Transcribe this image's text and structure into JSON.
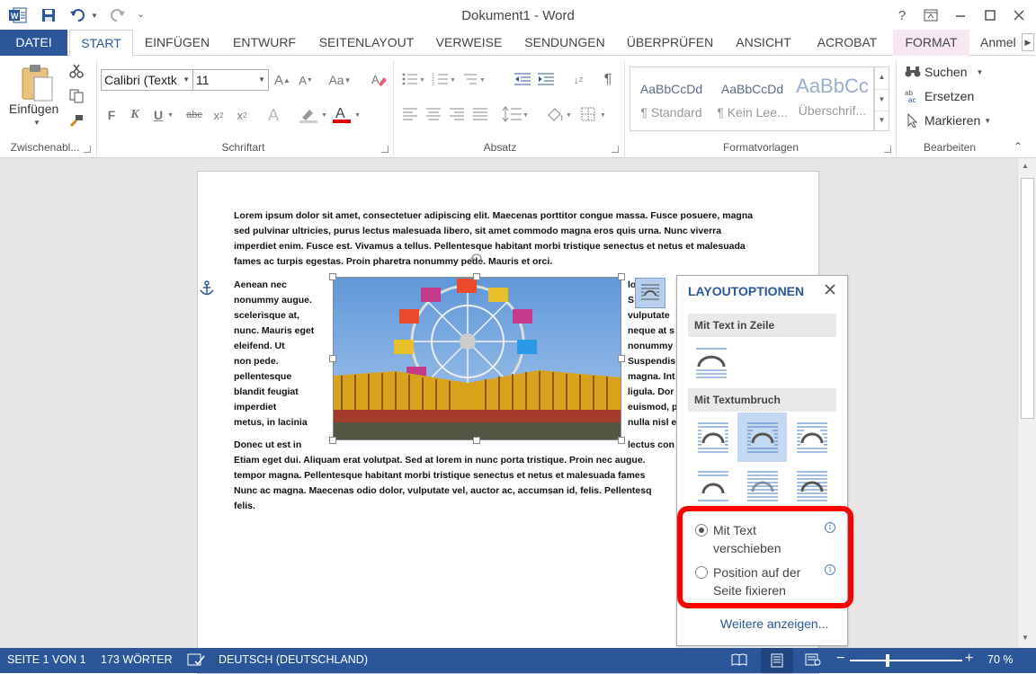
{
  "window": {
    "title": "Dokument1 - Word",
    "help": "?",
    "account": "Anmel"
  },
  "tabs": [
    "DATEI",
    "START",
    "EINFÜGEN",
    "ENTWURF",
    "SEITENLAYOUT",
    "VERWEISE",
    "SENDUNGEN",
    "ÜBERPRÜFEN",
    "ANSICHT",
    "ACROBAT",
    "FORMAT"
  ],
  "ribbon": {
    "clipboard": {
      "paste_label": "Einfügen",
      "group": "Zwischenabl..."
    },
    "font": {
      "family": "Calibri (Textk",
      "size": "11",
      "group": "Schriftart",
      "bold": "F",
      "italic": "K",
      "underline": "U",
      "strike": "abc"
    },
    "paragraph": {
      "group": "Absatz"
    },
    "styles": {
      "group": "Formatvorlagen",
      "items": [
        {
          "sample": "AaBbCcDd",
          "name": "¶ Standard"
        },
        {
          "sample": "AaBbCcDd",
          "name": "¶ Kein Lee..."
        },
        {
          "sample": "AaBbCc",
          "name": "Überschrif..."
        }
      ]
    },
    "editing": {
      "group": "Bearbeiten",
      "find": "Suchen",
      "replace": "Ersetzen",
      "select": "Markieren"
    }
  },
  "document": {
    "lines_top": [
      "Lorem ipsum dolor sit amet, consectetuer adipiscing elit. Maecenas porttitor congue massa. Fusce posuere, magna",
      "sed pulvinar ultricies, purus lectus malesuada libero, sit amet commodo magna eros quis urna. Nunc viverra",
      "imperdiet enim. Fusce est. Vivamus a tellus. Pellentesque habitant morbi tristique senectus et netus et malesuada",
      "fames ac turpis egestas. Proin pharetra nonummy pede. Mauris et orci."
    ],
    "lines_left": [
      "Aenean nec",
      "nonummy augue.",
      "scelerisque at,",
      "nunc. Mauris eget",
      "eleifend. Ut",
      "non pede.",
      "pellentesque",
      "blandit feugiat",
      "imperdiet",
      "metus, in lacinia"
    ],
    "lines_right": [
      "lo",
      "S",
      "vulputate",
      "neque at s",
      "nonummy",
      "Suspendis",
      "magna. Int",
      "ligula. Dor",
      "euismod, p",
      "nulla nisl e"
    ],
    "line_split": {
      "left": "Donec ut est in",
      "right": "lectus con"
    },
    "lines_bottom": [
      "Etiam eget dui. Aliquam erat volutpat. Sed at lorem in nunc porta tristique. Proin nec augue.",
      "tempor magna. Pellentesque habitant morbi tristique senectus et netus et malesuada fames",
      "Nunc ac magna. Maecenas odio dolor, vulputate vel, auctor ac, accumsan id, felis. Pellentesq",
      "felis."
    ]
  },
  "layout_panel": {
    "title": "LAYOUTOPTIONEN",
    "inline_header": "Mit Text in Zeile",
    "wrap_header": "Mit Textumbruch",
    "option_move": "Mit Text verschieben",
    "option_move_line1": "Mit Text",
    "option_move_line2": "verschieben",
    "option_fix_line1": "Position auf der",
    "option_fix_line2": "Seite fixieren",
    "selected_option": "Mit Text verschieben",
    "more_link": "Weitere anzeigen...",
    "highlight_color": "#ff0000"
  },
  "statusbar": {
    "page": "SEITE 1 VON 1",
    "words": "173 WÖRTER",
    "language": "DEUTSCH (DEUTSCHLAND)",
    "zoom": "70 %"
  },
  "colors": {
    "accent": "#2b579a",
    "format_tab": "#f7e7f0"
  }
}
